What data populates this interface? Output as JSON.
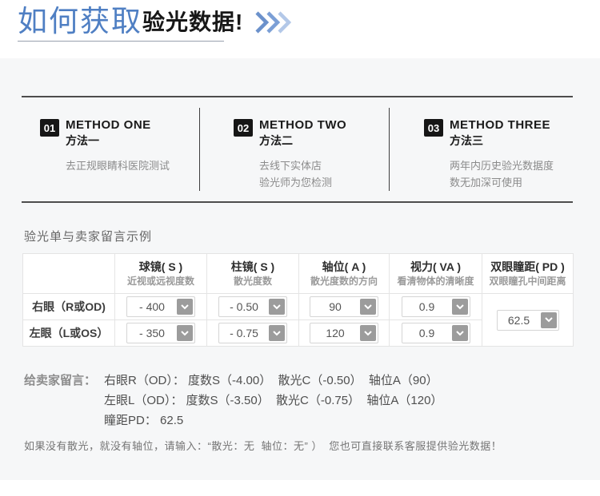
{
  "header": {
    "title_blue": "如何获取",
    "title_black": "验光数据!",
    "chevron_icon": "triple-chevron-right"
  },
  "methods": [
    {
      "num": "01",
      "title_en": "METHOD ONE",
      "title_cn": "方法一",
      "desc_lines": [
        "去正规眼睛科医院测试"
      ]
    },
    {
      "num": "02",
      "title_en": "METHOD TWO",
      "title_cn": "方法二",
      "desc_lines": [
        "去线下实体店",
        "验光师为您检测"
      ]
    },
    {
      "num": "03",
      "title_en": "METHOD THREE",
      "title_cn": "方法三",
      "desc_lines": [
        "两年内历史验光数据度",
        "数无加深可使用"
      ]
    }
  ],
  "table": {
    "section_title": "验光单与卖家留言示例",
    "columns": [
      {
        "title": "",
        "subtitle": ""
      },
      {
        "title": "球镜( S )",
        "subtitle": "近视或远视度数"
      },
      {
        "title": "柱镜( S )",
        "subtitle": "散光度数"
      },
      {
        "title": "轴位( A )",
        "subtitle": "散光度数的方向"
      },
      {
        "title": "视力( VA )",
        "subtitle": "看清物体的清晰度"
      },
      {
        "title": "双眼瞳距( PD )",
        "subtitle": "双眼瞳孔中间距离"
      }
    ],
    "rows": [
      {
        "label": "右眼（R或OD)",
        "values": [
          "- 400",
          "- 0.50",
          "90",
          "0.9"
        ]
      },
      {
        "label": "左眼（L或OS）",
        "values": [
          "- 350",
          "- 0.75",
          "120",
          "0.9"
        ]
      }
    ],
    "pd_value": "62.5"
  },
  "message": {
    "label": "给卖家留言：",
    "lines": [
      "右眼R（OD）： 度数S（-4.00）  散光C（-0.50）  轴位A（90）",
      "左眼L（OD）： 度数S（-3.50）  散光C（-0.75）  轴位A（120）",
      "瞳距PD： 62.5"
    ]
  },
  "note": "如果没有散光，就没有轴位，请输入：“散光：无  轴位：无” ）  您也可直接联系客服提供验光数据！",
  "colors": {
    "accent_blue": "#4f7fc3",
    "chevron_blue_dark": "#6b91cb",
    "chevron_blue_light": "#b3c8e8",
    "badge_black": "#161616",
    "panel_gray": "#f6f7f8",
    "rule_dark": "#4d4d4d",
    "dropdown_button_gray": "#9c9c9c",
    "table_border": "#e4e4e4"
  }
}
